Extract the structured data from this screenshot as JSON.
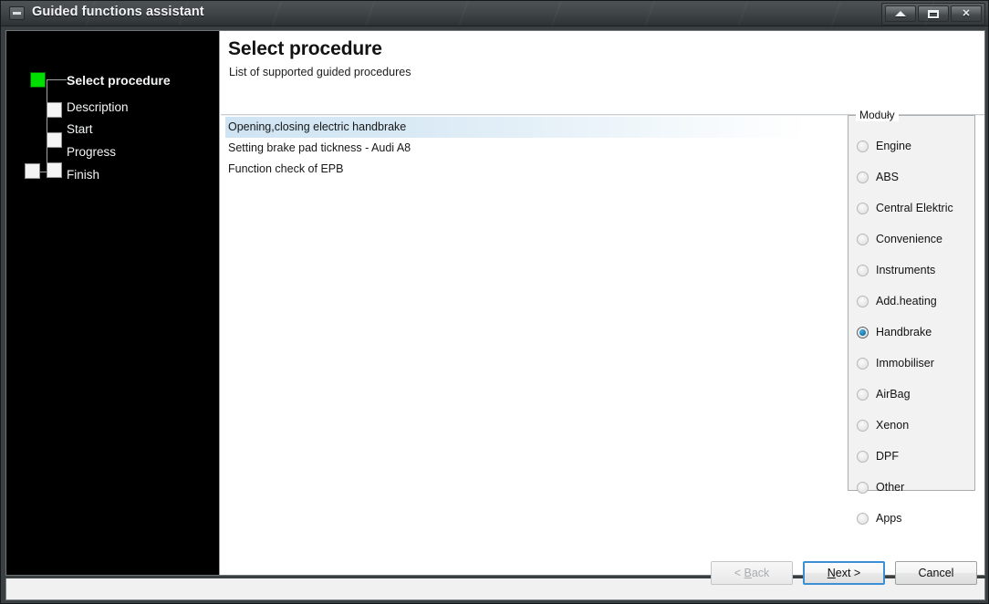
{
  "window": {
    "title": "Guided functions assistant",
    "icon": "window-menu-icon",
    "controls": {
      "minimize": "minimize-icon",
      "restore": "restore-icon",
      "close": "✕"
    }
  },
  "steps": {
    "items": [
      {
        "label": "Select procedure",
        "state": "active"
      },
      {
        "label": "Description",
        "state": "pending"
      },
      {
        "label": "Start",
        "state": "pending"
      },
      {
        "label": "Progress",
        "state": "pending"
      },
      {
        "label": "Finish",
        "state": "pending"
      }
    ]
  },
  "header": {
    "title": "Select procedure",
    "subtitle": "List of supported guided procedures"
  },
  "procedures": {
    "items": [
      {
        "label": "Opening,closing electric handbrake",
        "selected": true
      },
      {
        "label": "Setting brake pad tickness - Audi A8",
        "selected": false
      },
      {
        "label": "Function check of EPB",
        "selected": false
      }
    ]
  },
  "modules": {
    "legend": "Moduły",
    "items": [
      {
        "label": "Engine",
        "selected": false
      },
      {
        "label": "ABS",
        "selected": false
      },
      {
        "label": "Central Elektric",
        "selected": false
      },
      {
        "label": "Convenience",
        "selected": false
      },
      {
        "label": "Instruments",
        "selected": false
      },
      {
        "label": "Add.heating",
        "selected": false
      },
      {
        "label": "Handbrake",
        "selected": true
      },
      {
        "label": "Immobiliser",
        "selected": false
      },
      {
        "label": "AirBag",
        "selected": false
      },
      {
        "label": "Xenon",
        "selected": false
      },
      {
        "label": "DPF",
        "selected": false
      },
      {
        "label": "Other",
        "selected": false
      },
      {
        "label": "Apps",
        "selected": false
      }
    ]
  },
  "buttons": {
    "back": {
      "prefix": "< ",
      "accel": "B",
      "rest": "ack",
      "disabled": true
    },
    "next": {
      "prefix": "",
      "accel": "N",
      "rest": "ext >",
      "focused": true
    },
    "cancel": {
      "label": "Cancel"
    }
  },
  "colors": {
    "accent": "#3c8fd4",
    "active_step": "#00e000",
    "selection": "#cfe4f3",
    "titlebar": "#3f4447"
  }
}
